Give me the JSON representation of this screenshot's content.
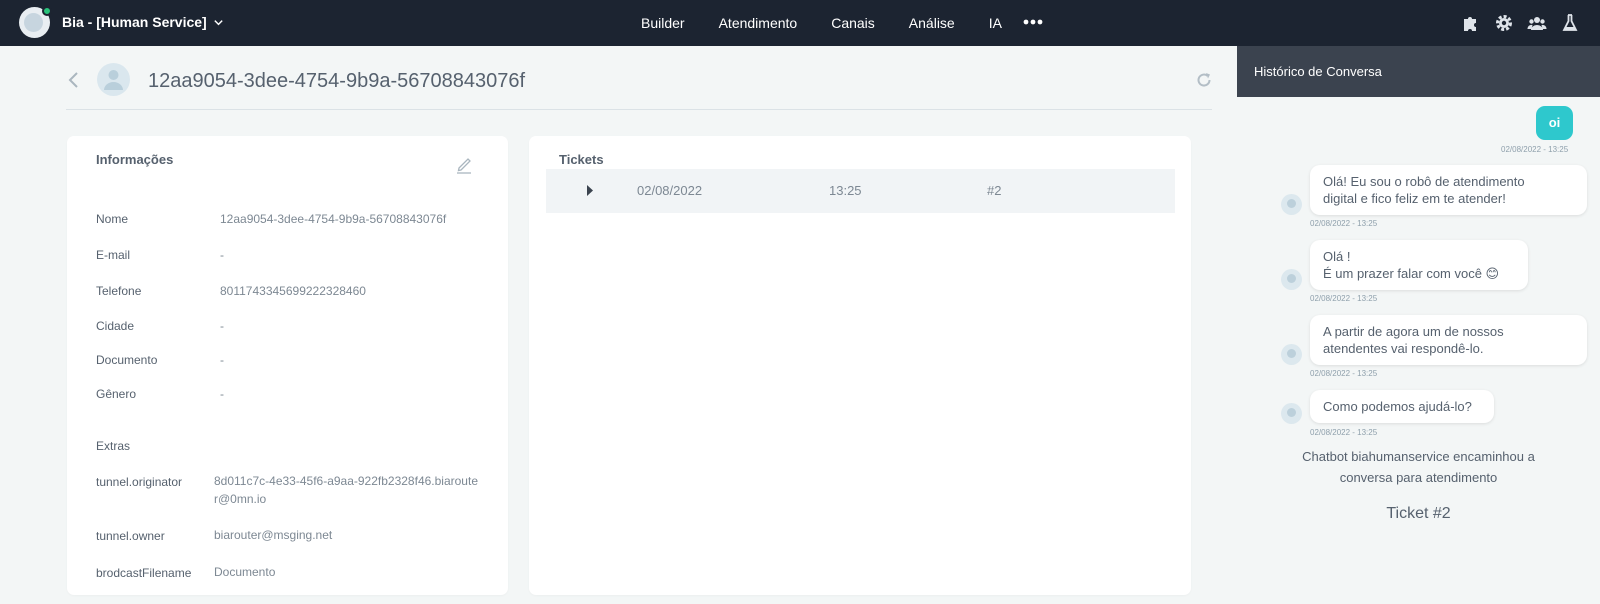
{
  "topbar": {
    "bot_name": "Bia - [Human Service]",
    "nav": [
      "Builder",
      "Atendimento",
      "Canais",
      "Análise",
      "IA"
    ],
    "icons": [
      "puzzle-icon",
      "gear-icon",
      "team-icon",
      "flask-icon"
    ]
  },
  "header": {
    "title": "12aa9054-3dee-4754-9b9a-56708843076f"
  },
  "info": {
    "title": "Informações",
    "fields": [
      {
        "label": "Nome",
        "value": "12aa9054-3dee-4754-9b9a-56708843076f"
      },
      {
        "label": "E-mail",
        "value": "-"
      },
      {
        "label": "Telefone",
        "value": "8011743345699222328460"
      },
      {
        "label": "Cidade",
        "value": "-"
      },
      {
        "label": "Documento",
        "value": "-"
      },
      {
        "label": "Gênero",
        "value": "-"
      }
    ],
    "extras_title": "Extras",
    "extras": [
      {
        "label": "tunnel.originator",
        "value": "8d011c7c-4e33-45f6-a9aa-922fb2328f46.biarouter@0mn.io"
      },
      {
        "label": "tunnel.owner",
        "value": "biarouter@msging.net"
      },
      {
        "label": "brodcastFilename",
        "value": "Documento"
      }
    ]
  },
  "tickets": {
    "title": "Tickets",
    "rows": [
      {
        "date": "02/08/2022",
        "time": "13:25",
        "number": "#2"
      }
    ]
  },
  "history": {
    "title": "Histórico de Conversa",
    "outgoing": {
      "text": "oi",
      "time": "02/08/2022 - 13:25"
    },
    "messages": [
      {
        "line1": "Olá! Eu sou o robô de atendimento",
        "line2": "digital e fico feliz em te atender!",
        "time": "02/08/2022 - 13:25"
      },
      {
        "line1": "Olá !",
        "line2": "É um prazer falar com você 😊",
        "time": "02/08/2022 - 13:25"
      },
      {
        "line1": "A partir de agora um de nossos",
        "line2": "atendentes vai respondê-lo.",
        "time": "02/08/2022 - 13:25"
      },
      {
        "line1": "Como podemos ajudá-lo?",
        "line2": "",
        "time": "02/08/2022 - 13:25"
      }
    ],
    "system_line1": "Chatbot biahumanservice encaminhou a",
    "system_line2": "conversa para atendimento",
    "ticket_label": "Ticket #2"
  }
}
